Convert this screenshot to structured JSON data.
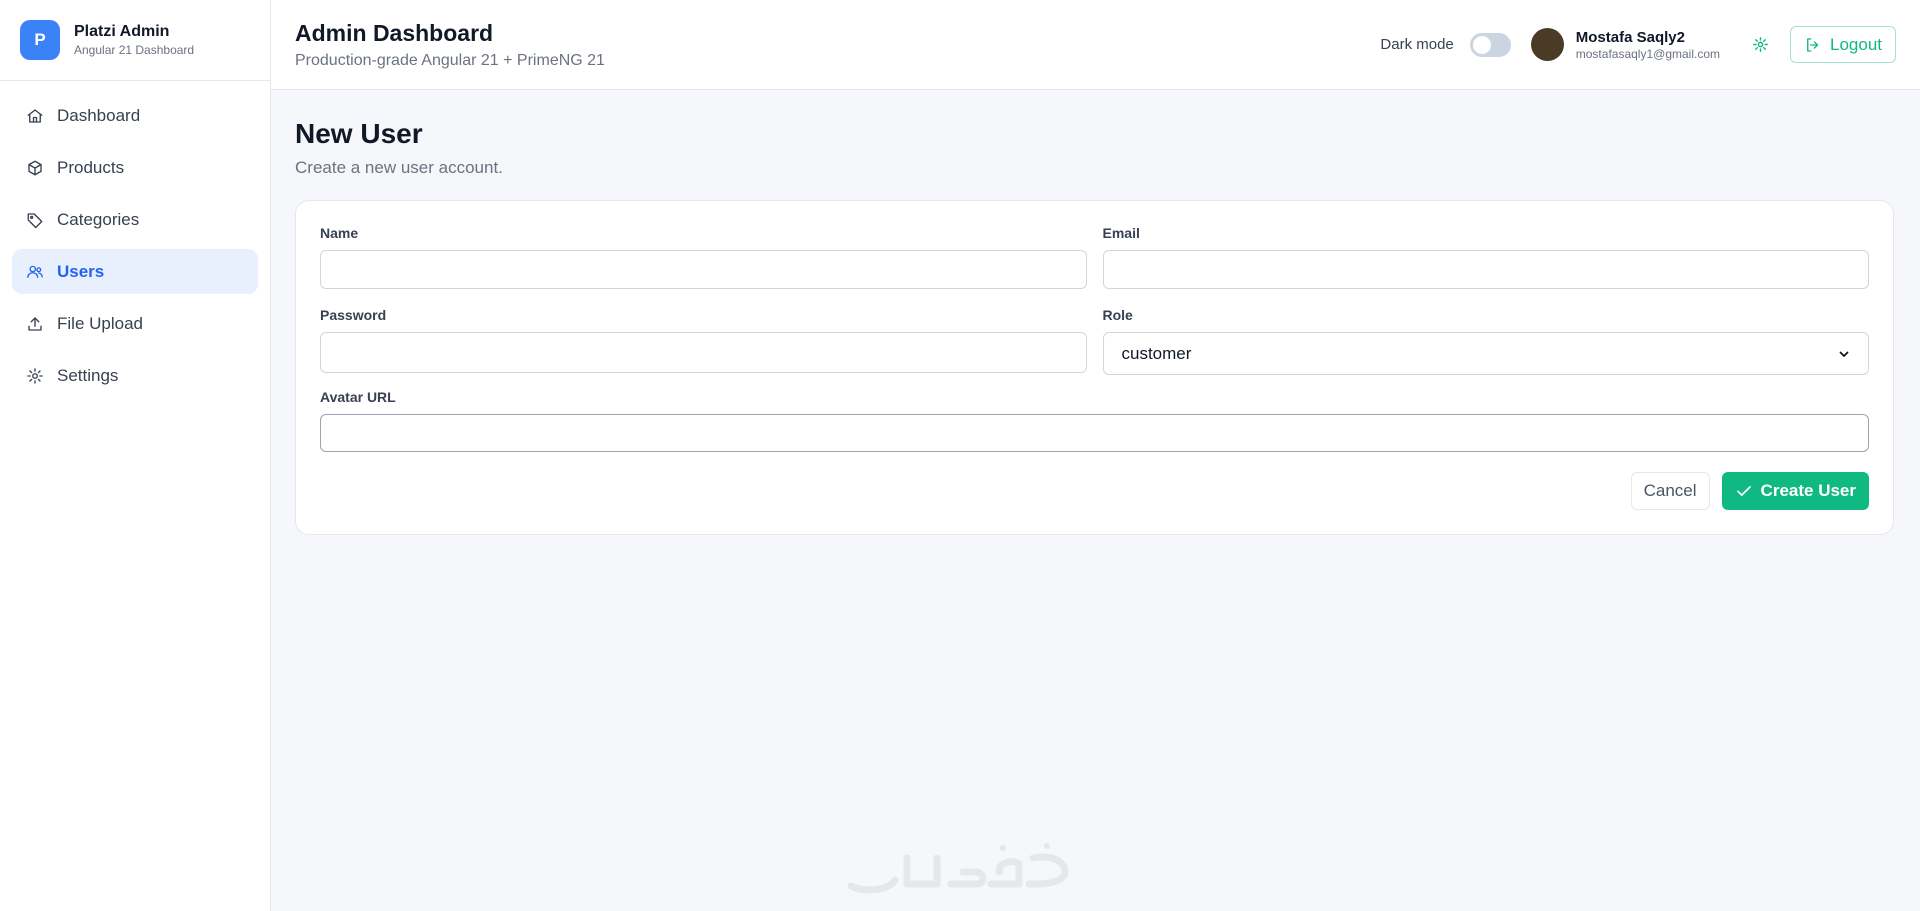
{
  "brand": {
    "logo_letter": "P",
    "title": "Platzi Admin",
    "subtitle": "Angular 21 Dashboard"
  },
  "sidebar": {
    "items": [
      {
        "label": "Dashboard",
        "icon": "home-icon",
        "active": false
      },
      {
        "label": "Products",
        "icon": "box-icon",
        "active": false
      },
      {
        "label": "Categories",
        "icon": "tag-icon",
        "active": false
      },
      {
        "label": "Users",
        "icon": "users-icon",
        "active": true
      },
      {
        "label": "File Upload",
        "icon": "upload-icon",
        "active": false
      },
      {
        "label": "Settings",
        "icon": "gear-icon",
        "active": false
      }
    ]
  },
  "header": {
    "title": "Admin Dashboard",
    "subtitle": "Production-grade Angular 21 + PrimeNG 21",
    "dark_mode_label": "Dark mode",
    "dark_mode_on": false,
    "user_name": "Mostafa Saqly2",
    "user_email": "mostafasaqly1@gmail.com",
    "logout_label": "Logout"
  },
  "page": {
    "title": "New User",
    "subtitle": "Create a new user account."
  },
  "form": {
    "name_label": "Name",
    "name_value": "",
    "email_label": "Email",
    "email_value": "",
    "password_label": "Password",
    "password_value": "",
    "role_label": "Role",
    "role_selected": "customer",
    "avatar_label": "Avatar URL",
    "avatar_value": "",
    "cancel_label": "Cancel",
    "create_label": "Create User"
  },
  "colors": {
    "primary": "#3b82f6",
    "active_bg": "#e8f0fd",
    "success": "#10b981",
    "background": "#f5f7fb"
  }
}
